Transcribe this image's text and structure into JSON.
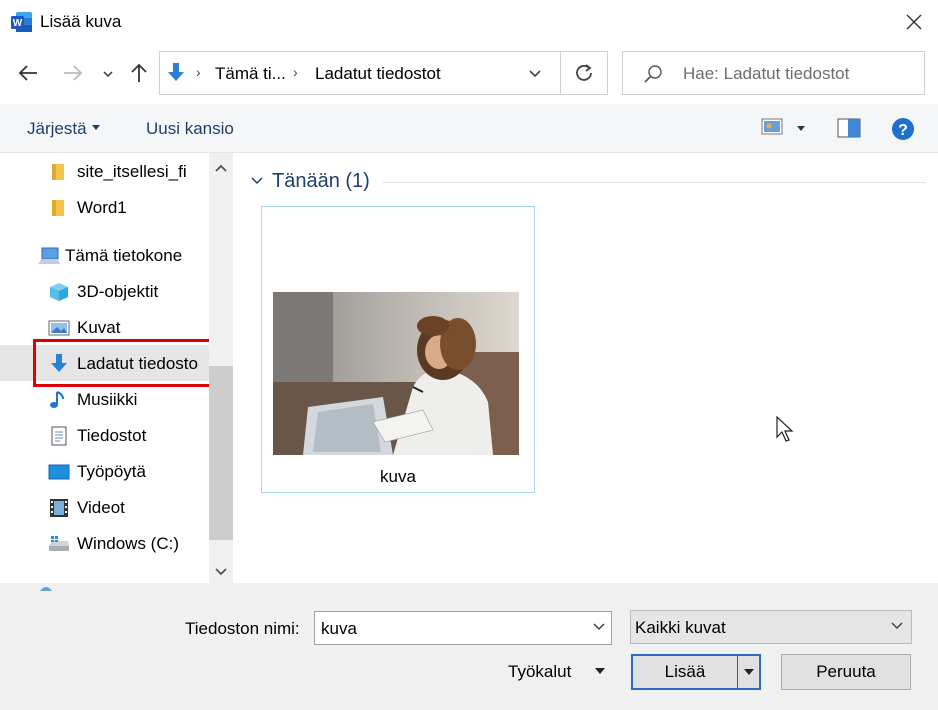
{
  "window": {
    "title": "Lisää kuva"
  },
  "address_bar": {
    "crumbs": [
      "Tämä ti...",
      "Ladatut tiedostot"
    ]
  },
  "search": {
    "placeholder": "Hae: Ladatut tiedostot"
  },
  "toolbar": {
    "organize_label": "Järjestä",
    "new_folder_label": "Uusi kansio"
  },
  "nav": {
    "items": [
      {
        "label": "site_itsellesi_fi",
        "icon": "folder-icon"
      },
      {
        "label": "Word1",
        "icon": "folder-icon"
      },
      {
        "label": "Tämä tietokone",
        "icon": "computer-icon"
      },
      {
        "label": "3D-objektit",
        "icon": "cube-icon"
      },
      {
        "label": "Kuvat",
        "icon": "pictures-icon"
      },
      {
        "label": "Ladatut tiedosto",
        "icon": "download-icon",
        "selected": true
      },
      {
        "label": "Musiikki",
        "icon": "music-icon"
      },
      {
        "label": "Tiedostot",
        "icon": "documents-icon"
      },
      {
        "label": "Työpöytä",
        "icon": "desktop-icon"
      },
      {
        "label": "Videot",
        "icon": "videos-icon"
      },
      {
        "label": "Windows (C:)",
        "icon": "drive-icon"
      }
    ]
  },
  "content": {
    "group_header": "Tänään (1)",
    "files": [
      {
        "name": "kuva"
      }
    ]
  },
  "footer": {
    "filename_label": "Tiedoston nimi:",
    "filename_value": "kuva",
    "filter_value": "Kaikki kuvat",
    "tools_label": "Työkalut",
    "add_label": "Lisää",
    "cancel_label": "Peruuta"
  },
  "colors": {
    "accent": "#2a6cc6",
    "highlight_box": "#e00000",
    "link_text": "#1f3f70"
  }
}
